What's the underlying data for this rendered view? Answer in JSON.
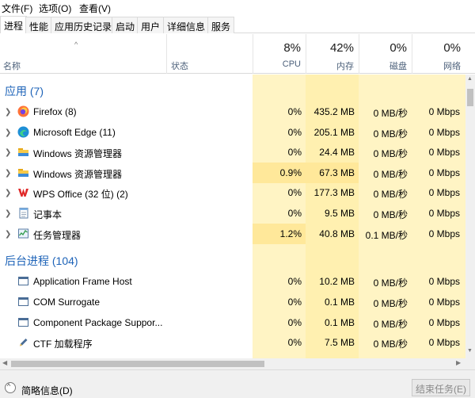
{
  "menu": [
    "文件(F)",
    "选项(O)",
    "查看(V)"
  ],
  "tabs": [
    "进程",
    "性能",
    "应用历史记录",
    "启动",
    "用户",
    "详细信息",
    "服务"
  ],
  "header": {
    "sort_arrow": "^",
    "name": "名称",
    "status": "状态",
    "cpu_pct": "8%",
    "cpu": "CPU",
    "mem_pct": "42%",
    "mem": "内存",
    "disk_pct": "0%",
    "disk": "磁盘",
    "net_pct": "0%",
    "net": "网络"
  },
  "groups": {
    "apps": "应用 (7)",
    "background": "后台进程 (104)"
  },
  "apps": [
    {
      "name": "Firefox (8)",
      "icon": "firefox-icon",
      "cpu": "0%",
      "mem": "435.2 MB",
      "disk": "0 MB/秒",
      "net": "0 Mbps"
    },
    {
      "name": "Microsoft Edge (11)",
      "icon": "edge-icon",
      "cpu": "0%",
      "mem": "205.1 MB",
      "disk": "0 MB/秒",
      "net": "0 Mbps"
    },
    {
      "name": "Windows 资源管理器",
      "icon": "folder-icon",
      "cpu": "0%",
      "mem": "24.4 MB",
      "disk": "0 MB/秒",
      "net": "0 Mbps"
    },
    {
      "name": "Windows 资源管理器",
      "icon": "folder-icon",
      "cpu": "0.9%",
      "mem": "67.3 MB",
      "disk": "0 MB/秒",
      "net": "0 Mbps"
    },
    {
      "name": "WPS Office (32 位) (2)",
      "icon": "wps-icon",
      "cpu": "0%",
      "mem": "177.3 MB",
      "disk": "0 MB/秒",
      "net": "0 Mbps"
    },
    {
      "name": "记事本",
      "icon": "notepad-icon",
      "cpu": "0%",
      "mem": "9.5 MB",
      "disk": "0 MB/秒",
      "net": "0 Mbps"
    },
    {
      "name": "任务管理器",
      "icon": "task-manager-icon",
      "cpu": "1.2%",
      "mem": "40.8 MB",
      "disk": "0.1 MB/秒",
      "net": "0 Mbps"
    }
  ],
  "background": [
    {
      "name": "Application Frame Host",
      "icon": "app-window-icon",
      "cpu": "0%",
      "mem": "10.2 MB",
      "disk": "0 MB/秒",
      "net": "0 Mbps"
    },
    {
      "name": "COM Surrogate",
      "icon": "app-window-icon",
      "cpu": "0%",
      "mem": "0.1 MB",
      "disk": "0 MB/秒",
      "net": "0 Mbps"
    },
    {
      "name": "Component Package Suppor...",
      "icon": "app-window-icon",
      "cpu": "0%",
      "mem": "0.1 MB",
      "disk": "0 MB/秒",
      "net": "0 Mbps"
    },
    {
      "name": "CTF 加载程序",
      "icon": "ctf-pen-icon",
      "cpu": "0%",
      "mem": "7.5 MB",
      "disk": "0 MB/秒",
      "net": "0 Mbps"
    }
  ],
  "footer": {
    "toggle_glyph": "^",
    "less_details": "简略信息(D)",
    "end_task": "结束任务(E)"
  },
  "colors": {
    "group_title": "#1d63b8",
    "cpu_col_bg": "#fff4c4",
    "mem_col_bg": "#fff0b0",
    "disk_col_bg": "#fff4c4",
    "net_col_bg": "#fff4c4",
    "row_highlight": "#ffe89a"
  }
}
